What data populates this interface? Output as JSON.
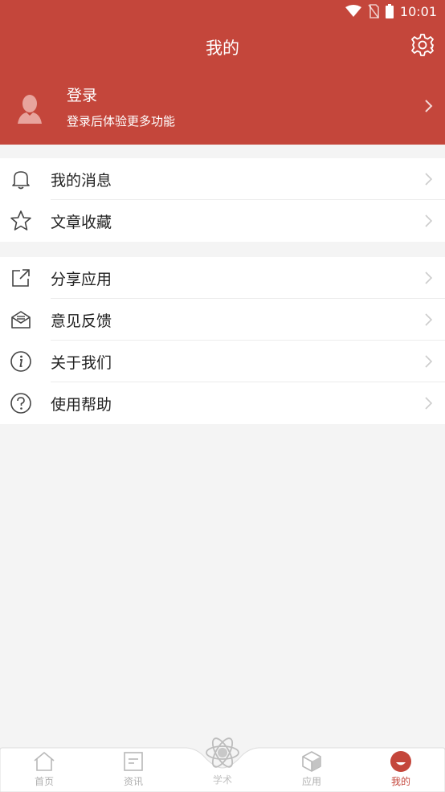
{
  "status_bar": {
    "time": "10:01"
  },
  "header": {
    "title": "我的"
  },
  "profile": {
    "login_label": "登录",
    "login_subtitle": "登录后体验更多功能"
  },
  "menu": {
    "group1": [
      {
        "label": "我的消息",
        "icon": "bell-icon"
      },
      {
        "label": "文章收藏",
        "icon": "star-icon"
      }
    ],
    "group2": [
      {
        "label": "分享应用",
        "icon": "share-icon"
      },
      {
        "label": "意见反馈",
        "icon": "feedback-mail-icon"
      },
      {
        "label": "关于我们",
        "icon": "info-icon"
      },
      {
        "label": "使用帮助",
        "icon": "help-icon"
      }
    ]
  },
  "tabbar": {
    "tabs": [
      {
        "label": "首页",
        "icon": "home-icon",
        "active": false
      },
      {
        "label": "资讯",
        "icon": "news-icon",
        "active": false
      },
      {
        "label": "学术",
        "icon": "atom-icon",
        "active": false
      },
      {
        "label": "应用",
        "icon": "cube-icon",
        "active": false
      },
      {
        "label": "我的",
        "icon": "profile-icon",
        "active": true
      }
    ]
  },
  "colors": {
    "brand": "#c4463b",
    "background": "#f4f4f4",
    "inactive_tab": "#b0b0b0"
  }
}
